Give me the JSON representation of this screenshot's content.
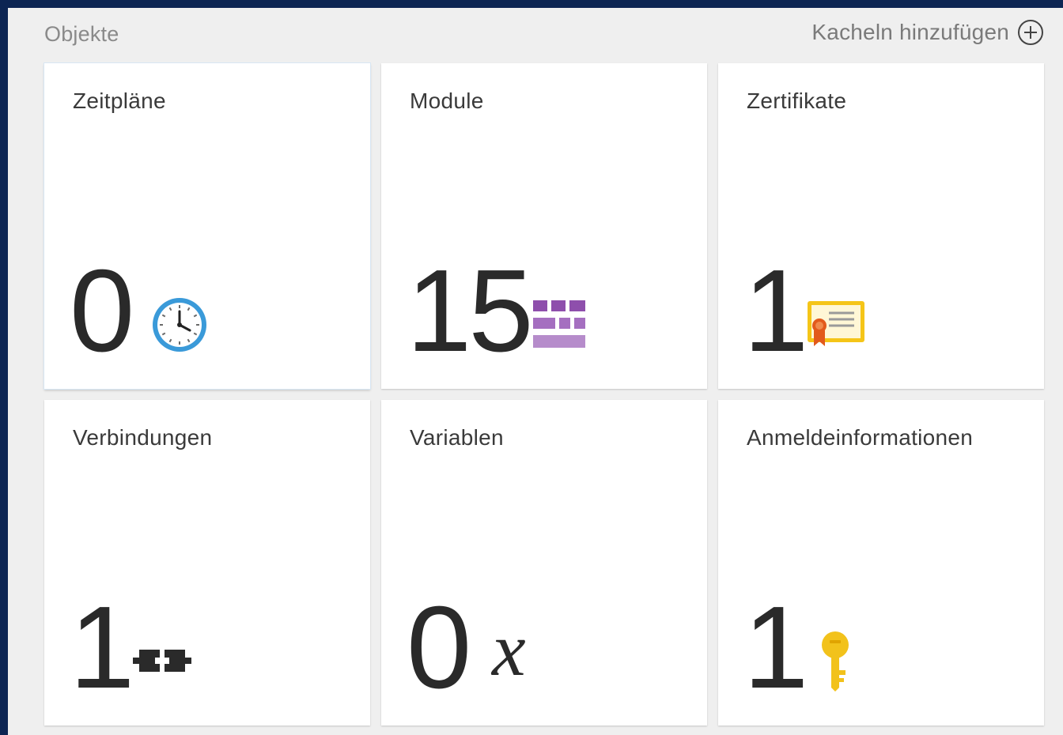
{
  "header": {
    "title": "Objekte",
    "add_tiles_label": "Kacheln hinzufügen"
  },
  "tiles": [
    {
      "title": "Zeitpläne",
      "count": "0",
      "icon": "clock-icon"
    },
    {
      "title": "Module",
      "count": "15",
      "icon": "modules-icon"
    },
    {
      "title": "Zertifikate",
      "count": "1",
      "icon": "certificate-icon"
    },
    {
      "title": "Verbindungen",
      "count": "1",
      "icon": "connection-icon"
    },
    {
      "title": "Variablen",
      "count": "0",
      "icon": "variable-icon",
      "icon_text": "x"
    },
    {
      "title": "Anmeldeinformationen",
      "count": "1",
      "icon": "key-icon"
    }
  ],
  "colors": {
    "outer_background": "#0d2553",
    "panel_background": "#efefef",
    "tile_background": "#ffffff",
    "module_purple": "#9a5fb5",
    "certificate_yellow": "#f5c518",
    "key_yellow": "#f2c21b",
    "clock_blue": "#3a9ad9"
  }
}
